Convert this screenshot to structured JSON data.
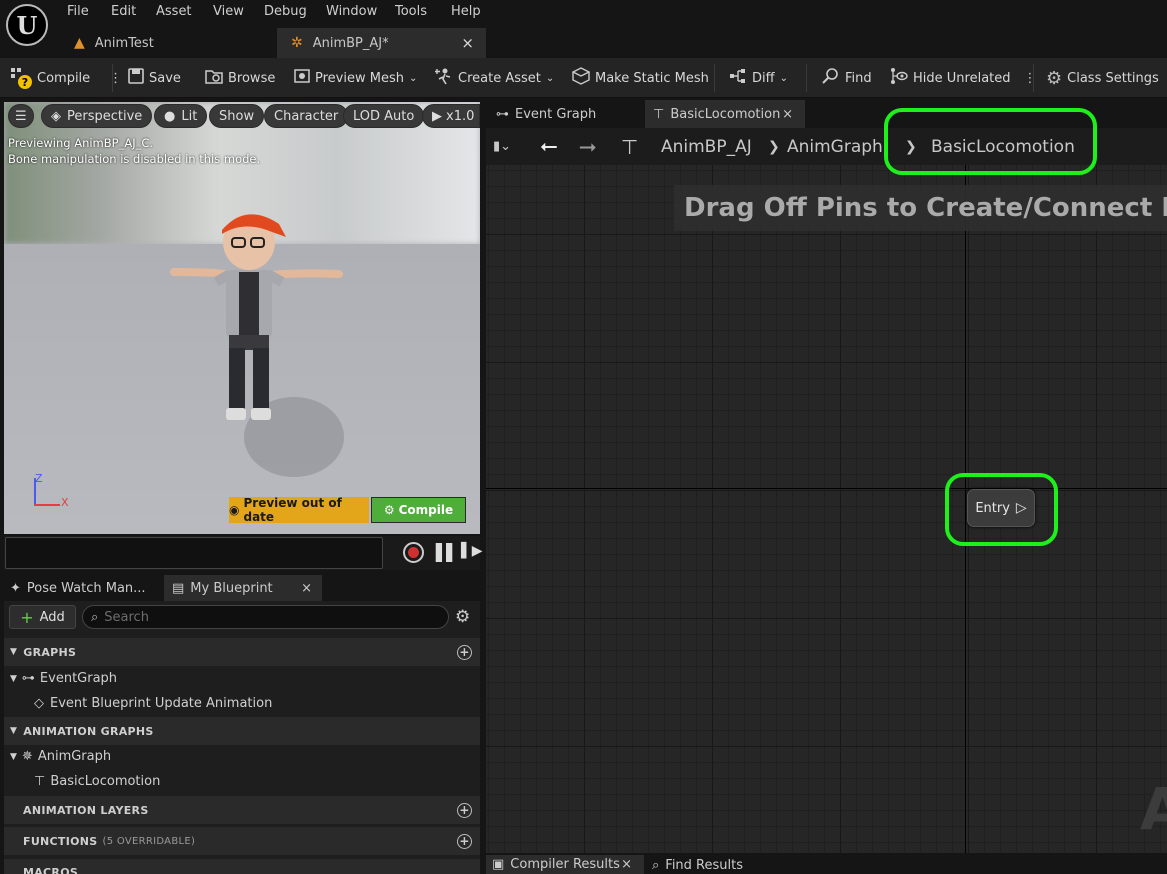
{
  "menu": [
    "File",
    "Edit",
    "Asset",
    "View",
    "Debug",
    "Window",
    "Tools",
    "Help"
  ],
  "logo_glyph": "U",
  "doc_tabs": [
    {
      "label": "AnimTest",
      "active": false
    },
    {
      "label": "AnimBP_AJ*",
      "active": true,
      "close": "×"
    }
  ],
  "toolbar": {
    "compile": "Compile",
    "save": "Save",
    "browse": "Browse",
    "preview_mesh": "Preview Mesh",
    "create_asset": "Create Asset",
    "make_static_mesh": "Make Static Mesh",
    "diff": "Diff",
    "find": "Find",
    "hide_unrelated": "Hide Unrelated",
    "class_settings": "Class Settings"
  },
  "viewport": {
    "perspective": "Perspective",
    "lit": "Lit",
    "show": "Show",
    "character": "Character",
    "lod": "LOD Auto",
    "speed": "x1.0",
    "line1": "Previewing AnimBP_AJ_C.",
    "line2": "Bone manipulation is disabled in this mode.",
    "preview_out": "Preview out of date",
    "compile": "Compile",
    "axis_z": "Z",
    "axis_x": "X"
  },
  "panel_tabs": [
    {
      "label": "Pose Watch Man..."
    },
    {
      "label": "My Blueprint",
      "close": "×"
    }
  ],
  "my_blueprint": {
    "add": "Add",
    "search_placeholder": "Search",
    "sections": {
      "graphs": "GRAPHS",
      "animation_graphs": "ANIMATION GRAPHS",
      "animation_layers": "ANIMATION LAYERS",
      "functions": "FUNCTIONS",
      "functions_note": "(5 OVERRIDABLE)",
      "macros": "MACROS"
    },
    "items": {
      "event_graph": "EventGraph",
      "event_update": "Event Blueprint Update Animation",
      "anim_graph": "AnimGraph",
      "basic_locomotion": "BasicLocomotion"
    }
  },
  "graph_tabs": [
    {
      "label": "Event Graph"
    },
    {
      "label": "BasicLocomotion",
      "close": "×",
      "active": true
    }
  ],
  "breadcrumb": [
    "AnimBP_AJ",
    "AnimGraph",
    "BasicLocomotion"
  ],
  "graph": {
    "hint": "Drag Off Pins to Create/Connect New N",
    "entry": "Entry",
    "watermark": "A"
  },
  "bottom_tabs": [
    {
      "label": "Compiler Results",
      "close": "×"
    },
    {
      "label": "Find Results"
    }
  ],
  "colors": {
    "highlight": "#1df01a",
    "preview_warning": "#e3a51a",
    "compile_green": "#4fae3a"
  }
}
